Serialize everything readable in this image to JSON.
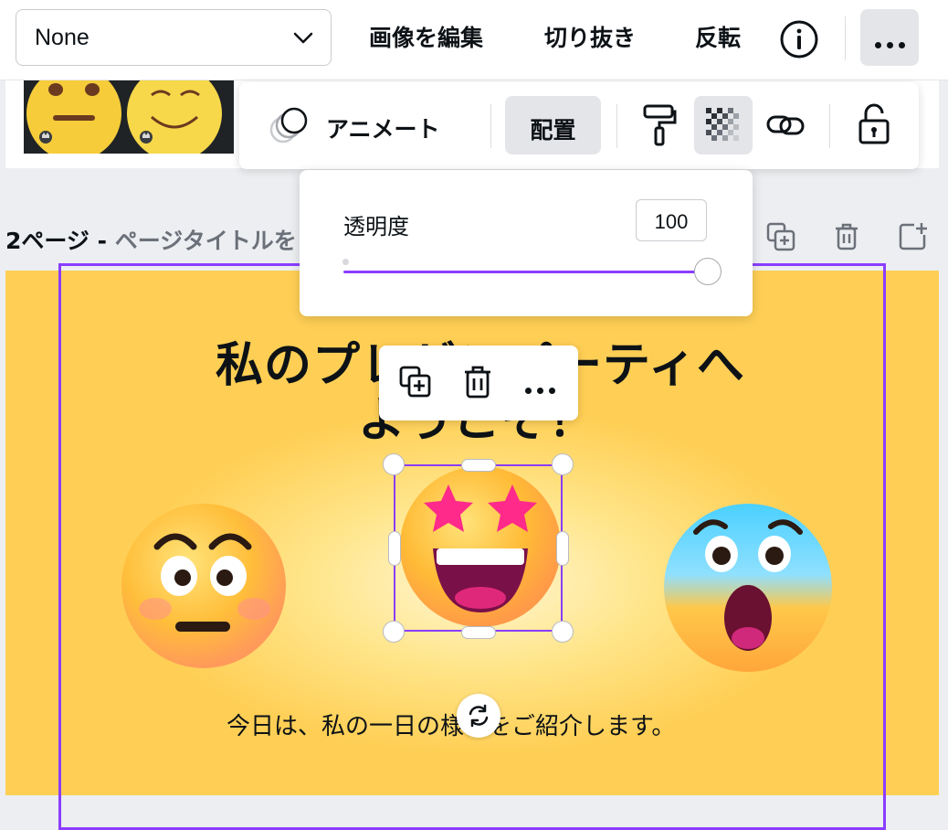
{
  "toolbar": {
    "filter_value": "None",
    "edit_image_label": "画像を編集",
    "crop_label": "切り抜き",
    "flip_label": "反転"
  },
  "secondary_toolbar": {
    "animate_label": "アニメート",
    "position_label": "配置"
  },
  "transparency": {
    "label": "透明度",
    "value": "100",
    "level_percent": 100
  },
  "page": {
    "number_label": "2ページ - ",
    "title_placeholder": "ページタイトルを"
  },
  "canvas": {
    "title_line1": "私のプレゼンパーティへ",
    "title_line2": "ようこそ！",
    "subtitle": "今日は、私の一日の様子をご紹介します。"
  },
  "colors": {
    "accent": "#8b3dff",
    "canvas_bg": "#ffcf55"
  }
}
